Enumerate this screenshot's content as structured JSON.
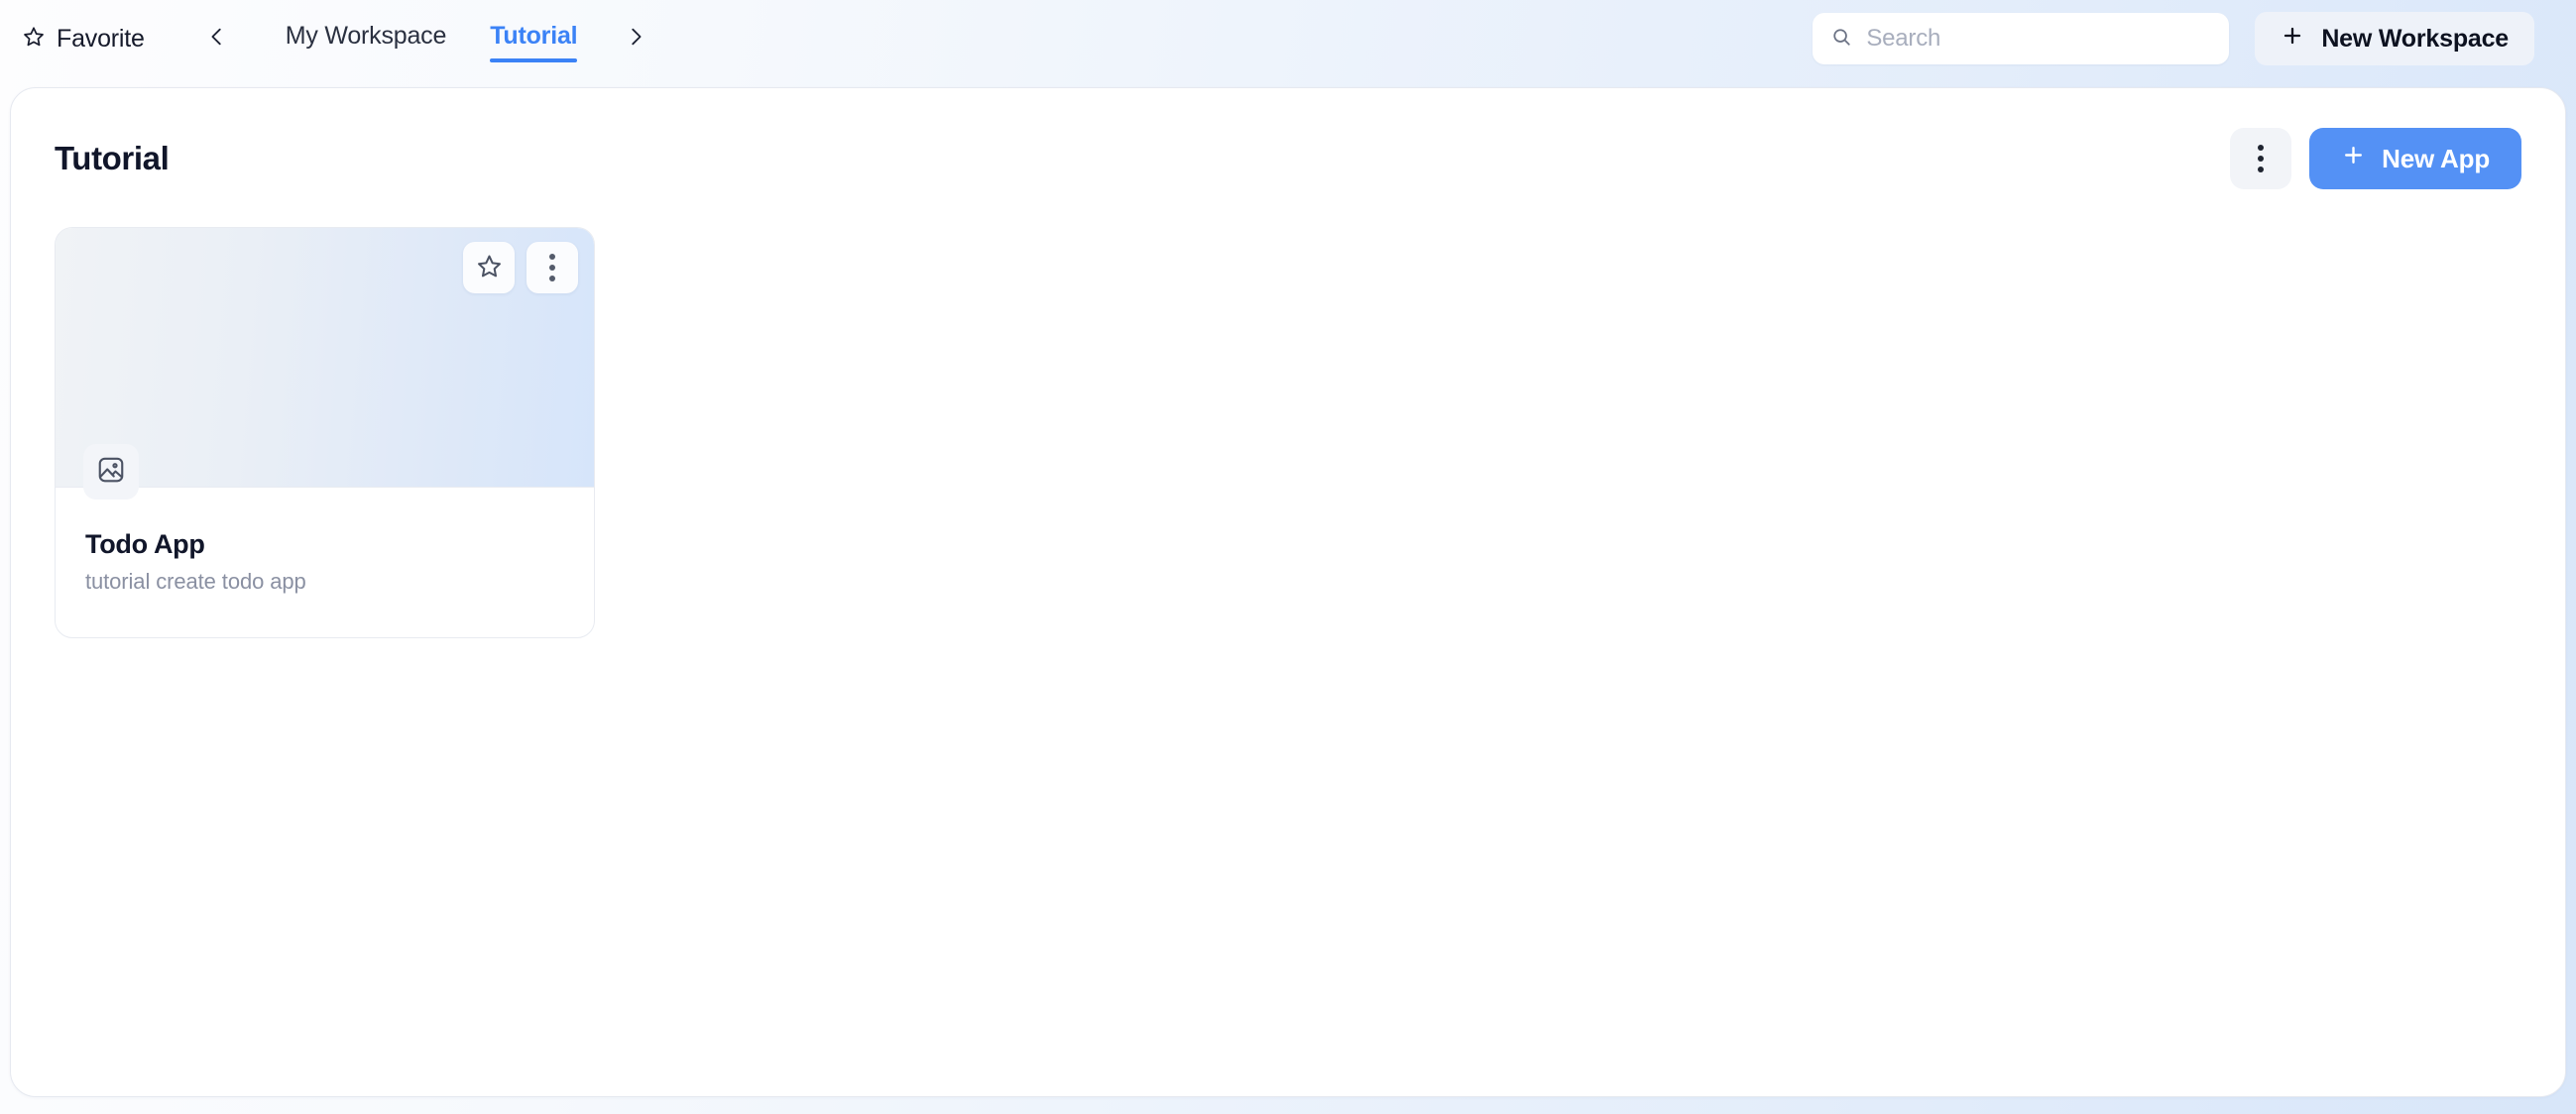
{
  "topbar": {
    "favorite": {
      "label": "Favorite",
      "icon": "star-outline-icon"
    },
    "prev_arrow_icon": "chevron-left-icon",
    "next_arrow_icon": "chevron-right-icon",
    "tabs": [
      {
        "label": "My Workspace",
        "active": false
      },
      {
        "label": "Tutorial",
        "active": true
      }
    ],
    "search": {
      "icon": "search-icon",
      "placeholder": "Search",
      "value": ""
    },
    "new_workspace": {
      "label": "New Workspace",
      "icon": "plus-icon"
    }
  },
  "panel": {
    "title": "Tutorial",
    "more_button": {
      "icon": "kebab-menu-icon"
    },
    "new_app": {
      "label": "New App",
      "icon": "plus-icon"
    },
    "apps": [
      {
        "title": "Todo App",
        "subtitle": "tutorial create todo app",
        "thumbnail_icon": "image-placeholder-icon",
        "favorite_icon": "star-outline-icon",
        "menu_icon": "kebab-menu-icon",
        "favorited": false
      }
    ]
  },
  "colors": {
    "accent": "#3b82f6",
    "primary_button": "#5491f5",
    "panel_background": "#ffffff",
    "page_background_start": "#fdfdfe",
    "page_background_end": "#d8e6f9",
    "muted_text": "#8a90a2",
    "heading_text": "#11162a"
  }
}
